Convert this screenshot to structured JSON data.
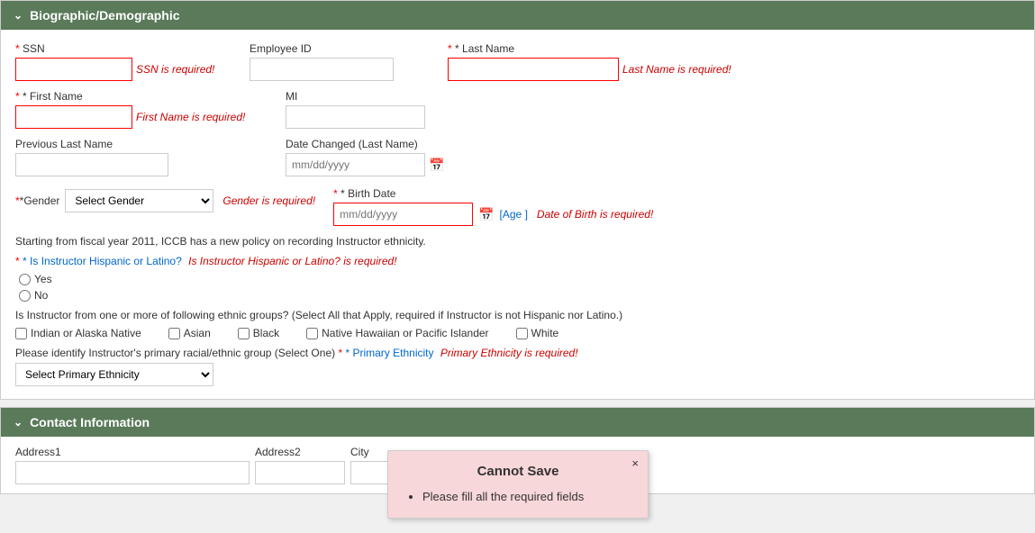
{
  "biographic": {
    "header": "Biographic/Demographic",
    "fields": {
      "ssn_label": "* SSN",
      "ssn_required": "SSN is required!",
      "employee_id_label": "Employee ID",
      "last_name_label": "* Last Name",
      "last_name_required": "Last Name is required!",
      "first_name_label": "* First Name",
      "first_name_required": "First Name is required!",
      "mi_label": "MI",
      "previous_last_name_label": "Previous Last Name",
      "date_changed_label": "Date Changed (Last Name)",
      "gender_label": "*Gender",
      "gender_required": "Gender is required!",
      "gender_placeholder": "Select Gender",
      "birth_date_label": "* Birth Date",
      "birth_date_placeholder": "mm/dd/yyyy",
      "birth_date_required": "Date of Birth is required!",
      "age_bracket": "[Age ]",
      "date_changed_placeholder": "mm/dd/yyyy"
    },
    "info_text": "Starting from fiscal year 2011, ICCB has a new policy on recording Instructor ethnicity.",
    "hispanic_question": "* Is Instructor Hispanic or Latino?",
    "hispanic_required": "Is Instructor Hispanic or Latino? is required!",
    "radio_yes": "Yes",
    "radio_no": "No",
    "ethnic_groups_question": "Is Instructor from one or more of following ethnic groups? (Select All that Apply, required if Instructor is not Hispanic nor Latino.)",
    "checkboxes": [
      "Indian or Alaska Native",
      "Asian",
      "Black",
      "Native Hawaiian or Pacific Islander",
      "White"
    ],
    "primary_ethnicity_question": "Please identify Instructor's primary racial/ethnic group (Select One)",
    "primary_ethnicity_label": "* Primary Ethnicity",
    "primary_ethnicity_required": "Primary Ethnicity is required!",
    "primary_ethnicity_placeholder": "Select Primary Ethnicity"
  },
  "contact": {
    "header": "Contact Information",
    "fields": {
      "address1_label": "Address1",
      "address2_label": "Address2",
      "city_label": "City"
    }
  },
  "cannot_save": {
    "title": "Cannot Save",
    "close_button": "×",
    "message": "Please fill all the required fields"
  }
}
